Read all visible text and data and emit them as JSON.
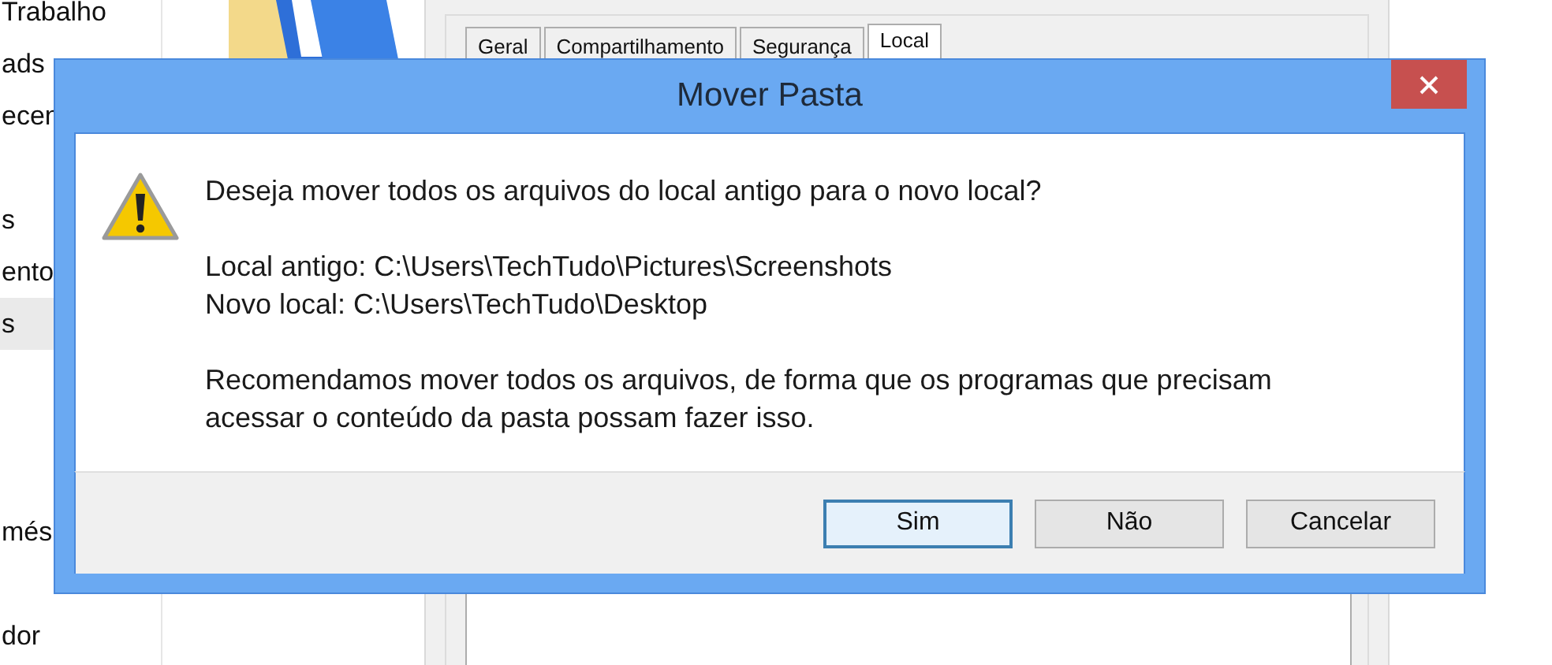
{
  "sidebar": {
    "items": [
      {
        "label": "Trabalho",
        "selected": false
      },
      {
        "label": "ads",
        "selected": false
      },
      {
        "label": "ecen",
        "selected": false
      },
      {
        "label": "s",
        "selected": false
      },
      {
        "label": "ento",
        "selected": false
      },
      {
        "label": "s",
        "selected": true
      },
      {
        "label": "més",
        "selected": false
      },
      {
        "label": "dor",
        "selected": false
      }
    ]
  },
  "properties": {
    "tabs": [
      {
        "label": "Geral",
        "selected": false
      },
      {
        "label": "Compartilhamento",
        "selected": false
      },
      {
        "label": "Segurança",
        "selected": false
      },
      {
        "label": "Local",
        "selected": true
      }
    ]
  },
  "dialog": {
    "title": "Mover Pasta",
    "question": "Deseja mover todos os arquivos do local antigo para o novo local?",
    "old_location": "Local antigo: C:\\Users\\TechTudo\\Pictures\\Screenshots",
    "new_location": "Novo local: C:\\Users\\TechTudo\\Desktop",
    "recommendation": "Recomendamos mover todos os arquivos, de forma que os programas que precisam acessar o conteúdo da pasta possam fazer isso.",
    "buttons": [
      {
        "label": "Sim",
        "default": true
      },
      {
        "label": "Não",
        "default": false
      },
      {
        "label": "Cancelar",
        "default": false
      }
    ]
  }
}
